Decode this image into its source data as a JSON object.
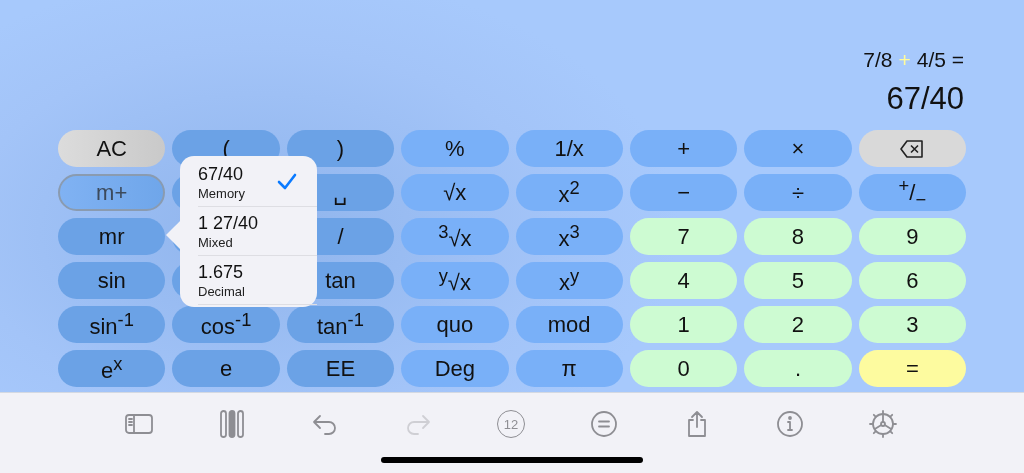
{
  "display": {
    "expression": [
      {
        "text": "7/8",
        "kind": "operand"
      },
      {
        "text": "+",
        "kind": "operator"
      },
      {
        "text": "4/5 =",
        "kind": "operand"
      }
    ],
    "result": "67/40"
  },
  "keypad": [
    [
      {
        "label": "AC",
        "kind": "clear"
      },
      {
        "label": "(",
        "kind": "fn"
      },
      {
        "label": ")",
        "kind": "fn"
      },
      {
        "label": "%",
        "kind": "op"
      },
      {
        "label": "1/x",
        "kind": "op"
      },
      {
        "label": "+",
        "kind": "op"
      },
      {
        "label": "×",
        "kind": "op"
      },
      {
        "kind": "delete"
      }
    ],
    [
      {
        "label": "m+",
        "kind": "memory"
      },
      {
        "kind": "fn"
      },
      {
        "label": "␣",
        "kind": "fn"
      },
      {
        "label": "√x",
        "kind": "op"
      },
      {
        "label": "x$^{2}$",
        "kind": "op"
      },
      {
        "label": "−",
        "kind": "op"
      },
      {
        "label": "÷",
        "kind": "op"
      },
      {
        "label": "$^{+}$/$_{−}$",
        "kind": "op"
      }
    ],
    [
      {
        "label": "mr",
        "kind": "fn"
      },
      {
        "kind": "fn"
      },
      {
        "label": "/",
        "kind": "fn"
      },
      {
        "label": "$^{3}$√x",
        "kind": "op"
      },
      {
        "label": "x$^{3}$",
        "kind": "op"
      },
      {
        "label": "7",
        "kind": "digit"
      },
      {
        "label": "8",
        "kind": "digit"
      },
      {
        "label": "9",
        "kind": "digit"
      }
    ],
    [
      {
        "label": "sin",
        "kind": "fn"
      },
      {
        "kind": "fn"
      },
      {
        "label": "tan",
        "kind": "fn"
      },
      {
        "label": "$^{y}$√x",
        "kind": "op"
      },
      {
        "label": "x$^{y}$",
        "kind": "op"
      },
      {
        "label": "4",
        "kind": "digit"
      },
      {
        "label": "5",
        "kind": "digit"
      },
      {
        "label": "6",
        "kind": "digit"
      }
    ],
    [
      {
        "label": "sin$^{-1}$",
        "kind": "fn"
      },
      {
        "label": "cos$^{-1}$",
        "kind": "fn"
      },
      {
        "label": "tan$^{-1}$",
        "kind": "fn"
      },
      {
        "label": "quo",
        "kind": "op"
      },
      {
        "label": "mod",
        "kind": "op"
      },
      {
        "label": "1",
        "kind": "digit"
      },
      {
        "label": "2",
        "kind": "digit"
      },
      {
        "label": "3",
        "kind": "digit"
      }
    ],
    [
      {
        "label": "e$^{x}$",
        "kind": "fn"
      },
      {
        "label": "e",
        "kind": "fn"
      },
      {
        "label": "EE",
        "kind": "fn"
      },
      {
        "label": "Deg",
        "kind": "op"
      },
      {
        "label": "π",
        "kind": "op"
      },
      {
        "label": "0",
        "kind": "digit"
      },
      {
        "label": ".",
        "kind": "digit"
      },
      {
        "label": "=",
        "kind": "equals"
      }
    ]
  ],
  "popover": {
    "items": [
      {
        "value": "67/40",
        "caption": "Memory",
        "selected": true
      },
      {
        "value": "1 27/40",
        "caption": "Mixed",
        "selected": false
      },
      {
        "value": "1.675",
        "caption": "Decimal",
        "selected": false
      }
    ]
  },
  "toolbar": [
    {
      "kind": "sidebar",
      "disabled": false
    },
    {
      "kind": "columns",
      "disabled": false
    },
    {
      "kind": "undo",
      "disabled": false
    },
    {
      "kind": "redo",
      "disabled": true
    },
    {
      "kind": "count",
      "label": "12",
      "disabled": false
    },
    {
      "kind": "equals",
      "disabled": false
    },
    {
      "kind": "share",
      "disabled": false
    },
    {
      "kind": "info",
      "disabled": false
    },
    {
      "kind": "settings",
      "disabled": false
    }
  ]
}
